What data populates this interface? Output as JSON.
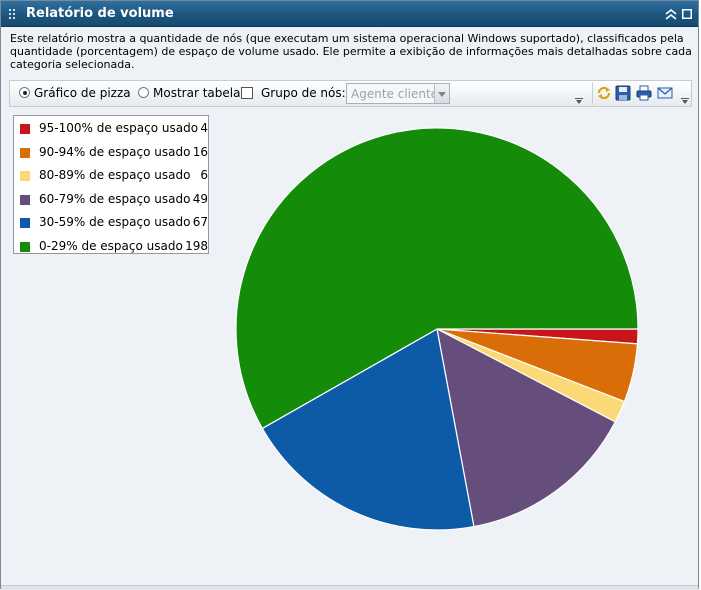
{
  "window": {
    "title": "Relatório de volume"
  },
  "description": "Este relatório mostra a quantidade de nós (que executam um sistema operacional Windows suportado), classificados pela quantidade (porcentagem) de espaço de volume usado. Ele permite a exibição de informações mais detalhadas sobre cada categoria selecionada.",
  "toolbar": {
    "pie_label": "Gráfico de pizza",
    "pie_selected": true,
    "table_label": "Mostrar tabela",
    "group_label": "Grupo de nós:",
    "group_checked": false,
    "group_select_value": "Agente cliente"
  },
  "icons": [
    "refresh-icon",
    "save-icon",
    "print-icon",
    "email-icon"
  ],
  "chart_data": {
    "type": "pie",
    "categories": [
      "95-100% de espaço usado",
      "90-94% de espaço usado",
      "80-89% de espaço usado",
      "60-79% de espaço usado",
      "30-59% de espaço usado",
      "0-29% de espaço usado"
    ],
    "values": [
      4,
      16,
      6,
      49,
      67,
      198
    ],
    "colors": [
      "#c8141b",
      "#d96d07",
      "#fbd977",
      "#654e7c",
      "#0d5ba7",
      "#148c0a"
    ],
    "legend_position": "top-left"
  }
}
